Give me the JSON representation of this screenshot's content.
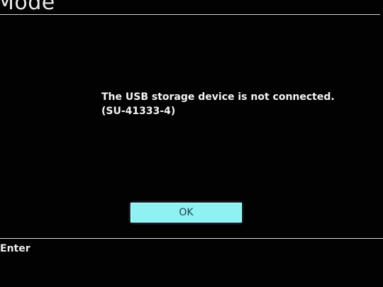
{
  "header": {
    "title": "Mode"
  },
  "dialog": {
    "message_line1": "The USB storage device is not connected.",
    "message_line2": "(SU-41333-4)",
    "ok_label": "OK"
  },
  "footer": {
    "hint_label": "Enter"
  },
  "colors": {
    "background": "#020203",
    "button_fill": "#8ef2f3",
    "button_text": "#1b3f55",
    "text": "#f4f4f4"
  }
}
